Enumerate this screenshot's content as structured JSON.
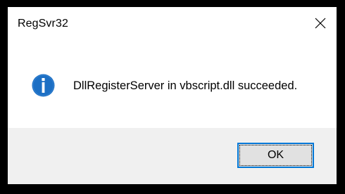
{
  "window": {
    "title": "RegSvr32"
  },
  "titlebar": {
    "close_icon": "close-icon"
  },
  "body": {
    "icon": "information-icon",
    "message": "DllRegisterServer in vbscript.dll succeeded."
  },
  "footer": {
    "ok_label": "OK"
  },
  "colors": {
    "info_icon_fill": "#1c6fc4",
    "button_focus_border": "#0078d7",
    "footer_background": "#f0f0f0",
    "button_background": "#e1e1e1"
  }
}
